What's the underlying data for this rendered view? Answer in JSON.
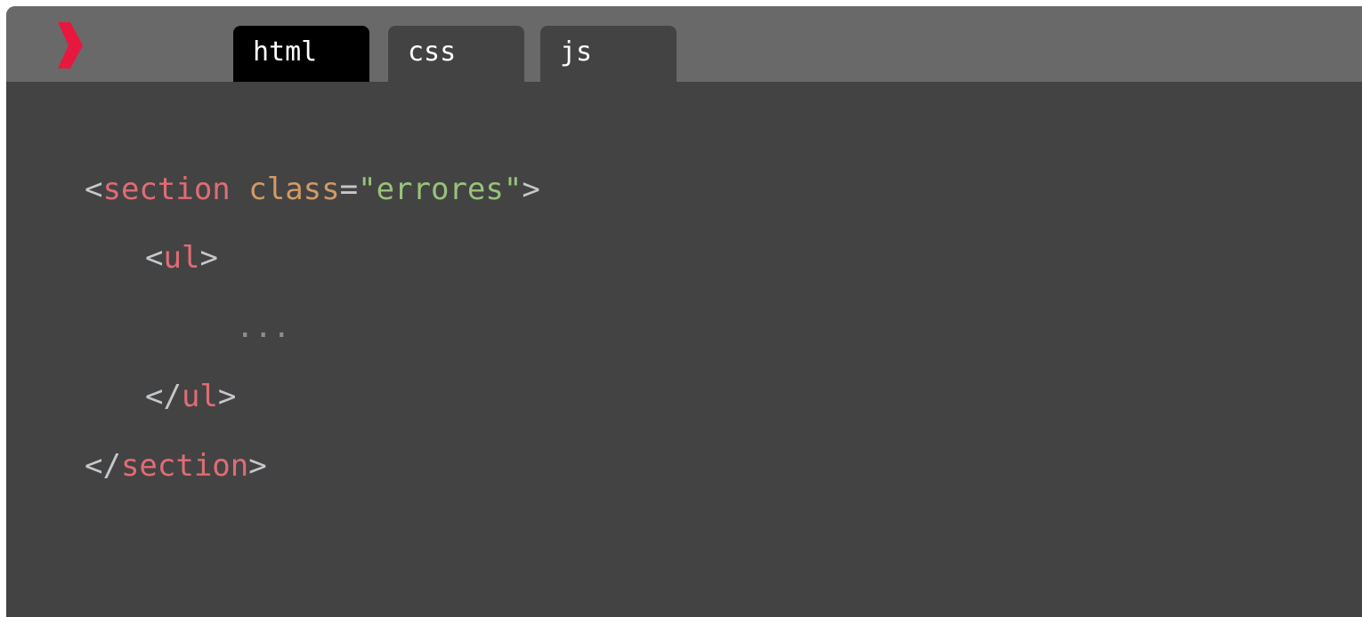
{
  "logo": {
    "icon": "chevron-right-icon",
    "color": "#e8173d"
  },
  "tabs": [
    {
      "label": "html",
      "active": true
    },
    {
      "label": "css",
      "active": false
    },
    {
      "label": "js",
      "active": false
    }
  ],
  "code": {
    "line1": {
      "open": "<",
      "tag": "section",
      "space": " ",
      "attr": "class",
      "eq": "=",
      "value": "\"errores\"",
      "close": ">"
    },
    "line2": {
      "open": "<",
      "tag": "ul",
      "close": ">"
    },
    "line3": {
      "text": "..."
    },
    "line4": {
      "open": "</",
      "tag": "ul",
      "close": ">"
    },
    "line5": {
      "open": "</",
      "tag": "section",
      "close": ">"
    }
  },
  "colors": {
    "titlebar": "#696969",
    "editor_bg": "#434343",
    "tag": "#e06c75",
    "attr": "#d19a66",
    "string": "#98c379",
    "punctuation": "#c4c8cc"
  }
}
